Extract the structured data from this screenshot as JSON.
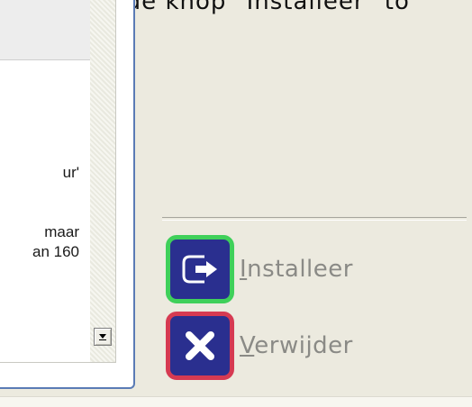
{
  "top_text": "op de knop \"Installeer\" to",
  "left_panel": {
    "lines": [
      "ur'",
      "maar",
      "an 160"
    ]
  },
  "actions": {
    "install": {
      "accel": "I",
      "rest": "nstalleer"
    },
    "remove": {
      "accel": "V",
      "rest": "erwijder"
    }
  },
  "icons": {
    "install": "install-arrow-icon",
    "remove": "remove-x-icon",
    "scroll": "scroll-down-arrow-icon"
  },
  "colors": {
    "install_border": "#3fd05a",
    "remove_border": "#d63a52",
    "tile_fill": "#2a2f8f"
  }
}
